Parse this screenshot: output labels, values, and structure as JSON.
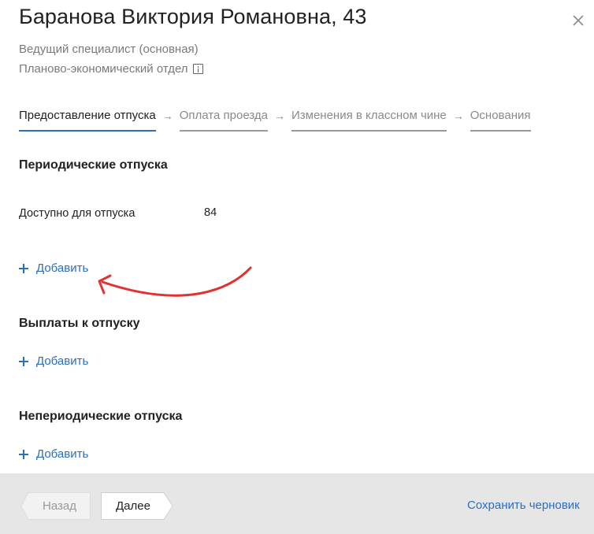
{
  "header": {
    "title": "Баранова Виктория Романовна, 43",
    "position": "Ведущий специалист (основная)",
    "department": "Планово-экономический отдел"
  },
  "steps": [
    {
      "label": "Предоставление отпуска",
      "active": true
    },
    {
      "label": "Оплата проезда",
      "active": false
    },
    {
      "label": "Изменения в классном чине",
      "active": false
    },
    {
      "label": "Основания",
      "active": false
    }
  ],
  "sections": {
    "periodic": {
      "title": "Периодические отпуска",
      "available_label": "Доступно для отпуска",
      "available_value": "84",
      "add_label": "Добавить"
    },
    "payments": {
      "title": "Выплаты к отпуску",
      "add_label": "Добавить"
    },
    "nonperiodic": {
      "title": "Непериодические отпуска",
      "add_label": "Добавить"
    }
  },
  "footer": {
    "back_label": "Назад",
    "next_label": "Далее",
    "save_draft_label": "Сохранить черновик"
  },
  "colors": {
    "accent": "#2a6fbf",
    "annotation_arrow": "#e2312f",
    "footer_bg": "#e6e6e6"
  }
}
